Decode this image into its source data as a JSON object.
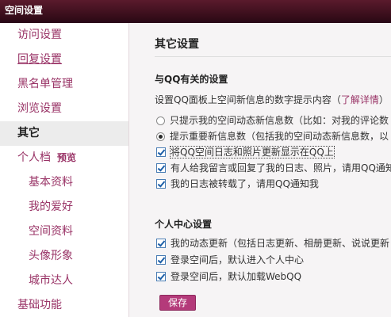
{
  "window": {
    "title": "空间设置"
  },
  "sidebar": {
    "items": [
      {
        "label": "访问设置"
      },
      {
        "label": "回复设置"
      },
      {
        "label": "黑名单管理"
      },
      {
        "label": "浏览设置"
      },
      {
        "label": "其它"
      },
      {
        "label": "个人档",
        "badge": "预览"
      },
      {
        "label": "基本资料"
      },
      {
        "label": "我的爱好"
      },
      {
        "label": "空间资料"
      },
      {
        "label": "头像形象"
      },
      {
        "label": "城市达人"
      },
      {
        "label": "基础功能"
      }
    ]
  },
  "main": {
    "title": "其它设置",
    "qq_section": {
      "title": "与QQ有关的设置",
      "description": "设置QQ面板上空间新信息的数字提示内容（",
      "learn_more": "了解详情",
      "description_end": "）",
      "radios": [
        {
          "label": "只提示我的空间动态新信息数（比如：对我的评论数",
          "checked": false
        },
        {
          "label": "提示重要新信息数（包括我的空间动态新信息数，以",
          "checked": true
        }
      ],
      "checkboxes": [
        {
          "label": "将QQ空间日志和照片更新显示在QQ上",
          "checked": true
        },
        {
          "label": "有人给我留言或回复了我的日志、照片，请用QQ通知",
          "checked": true
        },
        {
          "label": "我的日志被转载了，请用QQ通知我",
          "checked": true
        }
      ]
    },
    "personal_section": {
      "title": "个人中心设置",
      "checkboxes": [
        {
          "label": "我的动态更新（包括日志更新、相册更新、说说更新",
          "checked": true
        },
        {
          "label": "登录空间后，默认进入个人中心",
          "checked": true
        },
        {
          "label": "登录空间后，默认加载WebQQ",
          "checked": true
        }
      ]
    },
    "save_label": "保存"
  },
  "colors": {
    "accent": "#993366",
    "save_button": "#b43a7a",
    "title_bar": "#3a0d1c"
  }
}
